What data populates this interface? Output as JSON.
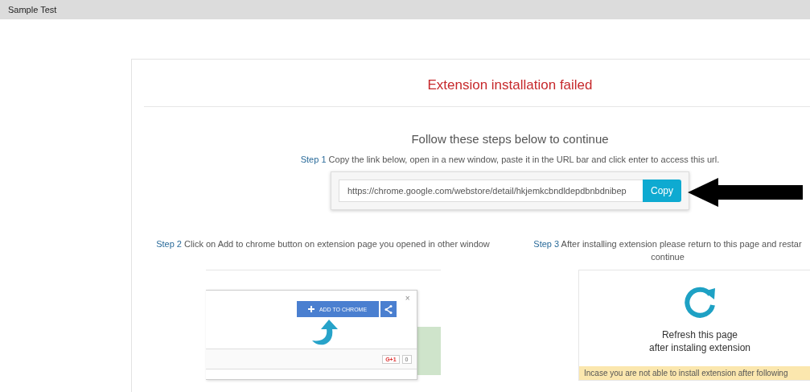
{
  "window": {
    "title": "Sample Test"
  },
  "heading": "Extension installation failed",
  "subheading": "Follow these steps below to continue",
  "step1": {
    "label": "Step 1",
    "text": "Copy the link below, open in a new window, paste it in the URL bar and click enter to access this url.",
    "url": "https://chrome.google.com/webstore/detail/hkjemkcbndldepdbnbdnibep",
    "button": "Copy"
  },
  "step2": {
    "label": "Step 2",
    "text": "Click on Add to chrome button on extension page you opened in other window",
    "preview": {
      "close": "×",
      "button": "ADD TO CHROME",
      "plus_one": "G+1",
      "count": "0"
    }
  },
  "step3": {
    "label": "Step 3",
    "lines": [
      "After installing extension please return to this page and restar",
      "continue"
    ],
    "preview": {
      "message_lines": [
        "Refresh this page",
        "after instaling extension"
      ],
      "notice": "Incase you are not able to install extension after following"
    }
  }
}
